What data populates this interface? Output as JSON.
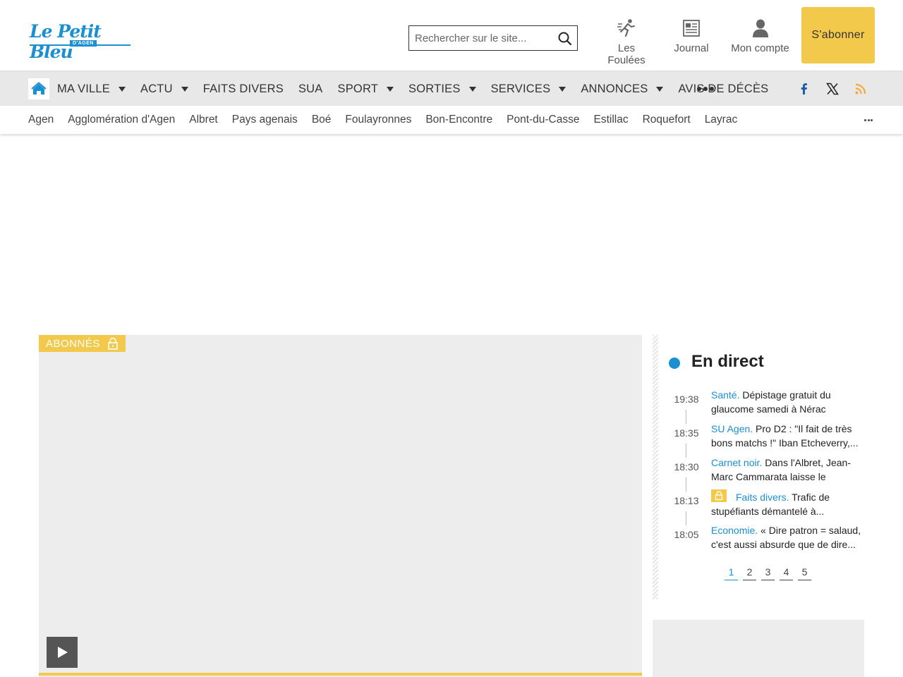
{
  "logo": {
    "main": "Le Petit Bleu",
    "sub": "D'AGEN"
  },
  "search": {
    "placeholder": "Rechercher sur le site..."
  },
  "tools": {
    "foulees": "Les Foulées",
    "journal": "Journal",
    "compte": "Mon compte"
  },
  "subscribe": "S'abonner",
  "nav": {
    "items": [
      {
        "label": "Ma ville",
        "dropdown": true
      },
      {
        "label": "Actu",
        "dropdown": true
      },
      {
        "label": "Faits divers",
        "dropdown": false
      },
      {
        "label": "SUA",
        "dropdown": false
      },
      {
        "label": "Sport",
        "dropdown": true
      },
      {
        "label": "Sorties",
        "dropdown": true
      },
      {
        "label": "Services",
        "dropdown": true
      },
      {
        "label": "Annonces",
        "dropdown": true
      },
      {
        "label": "Avis de décès",
        "dropdown": false
      }
    ]
  },
  "subnav": {
    "items": [
      "Agen",
      "Agglomération d'Agen",
      "Albret",
      "Pays agenais",
      "Boé",
      "Foulayronnes",
      "Bon-Encontre",
      "Pont-du-Casse",
      "Estillac",
      "Roquefort",
      "Layrac"
    ]
  },
  "video": {
    "badge": "ABONNÉS"
  },
  "live": {
    "title": "En direct",
    "items": [
      {
        "time": "19:38",
        "category": "Santé.",
        "text": "Dépistage gratuit du glaucome samedi à Nérac",
        "locked": false
      },
      {
        "time": "18:35",
        "category": "SU Agen.",
        "text": "Pro D2 : \"Il fait de très bons matchs !\" Iban Etcheverry,...",
        "locked": false
      },
      {
        "time": "18:30",
        "category": "Carnet noir.",
        "text": "Dans l'Albret, Jean-Marc Cammarata laisse le souvenir...",
        "locked": false
      },
      {
        "time": "18:13",
        "category": "Faits divers.",
        "text": "Trafic de stupéfiants démantelé à...",
        "locked": true
      },
      {
        "time": "18:05",
        "category": "Economie.",
        "text": "« Dire patron = salaud, c'est aussi absurde que de dire...",
        "locked": false
      }
    ],
    "pages": [
      "1",
      "2",
      "3",
      "4",
      "5"
    ],
    "active_page": "1"
  },
  "colors": {
    "accent": "#1a8fd1",
    "subscribe": "#f3c94b",
    "nav_bg": "#e8e8e8"
  },
  "icons": {
    "home": "home-icon",
    "search": "search-icon",
    "foulees": "runner-icon",
    "journal": "newspaper-icon",
    "compte": "user-icon",
    "facebook": "facebook-icon",
    "x": "x-icon",
    "rss": "rss-icon",
    "lock": "lock-icon",
    "play": "play-icon"
  }
}
